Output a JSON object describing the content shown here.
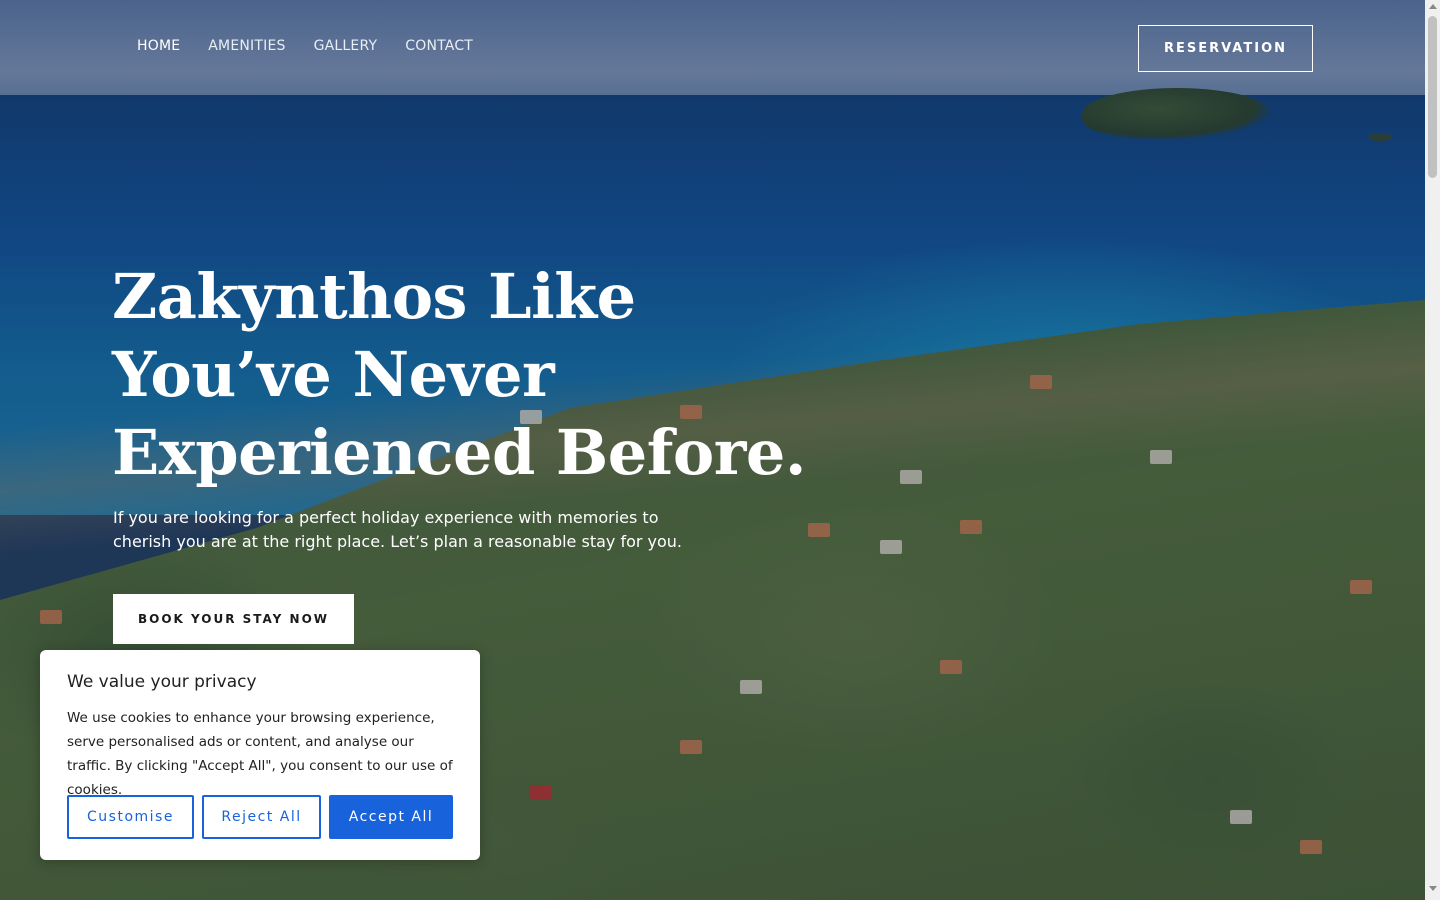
{
  "nav": {
    "items": [
      {
        "label": "HOME",
        "active": true
      },
      {
        "label": "AMENITIES",
        "active": false
      },
      {
        "label": "GALLERY",
        "active": false
      },
      {
        "label": "CONTACT",
        "active": false
      }
    ],
    "reservation_label": "RESERVATION"
  },
  "hero": {
    "title": "Zakynthos Like You’ve Never Experienced Before.",
    "subtitle": "If you are looking for a perfect holiday experience with memories to cherish you are at the right place. Let’s plan a reasonable stay for you.",
    "cta_label": "BOOK YOUR STAY NOW"
  },
  "cookie_banner": {
    "title": "We value your privacy",
    "text": "We use cookies to enhance your browsing experience, serve personalised ads or content, and analyse our traffic. By clicking \"Accept All\", you consent to our use of cookies.",
    "customise_label": "Customise",
    "reject_label": "Reject All",
    "accept_label": "Accept All"
  },
  "colors": {
    "accent": "#1863dc",
    "text_dark": "#212121",
    "white": "#ffffff"
  },
  "icons": {
    "scroll_up": "scroll-up-arrow-icon",
    "scroll_down": "scroll-down-arrow-icon"
  }
}
